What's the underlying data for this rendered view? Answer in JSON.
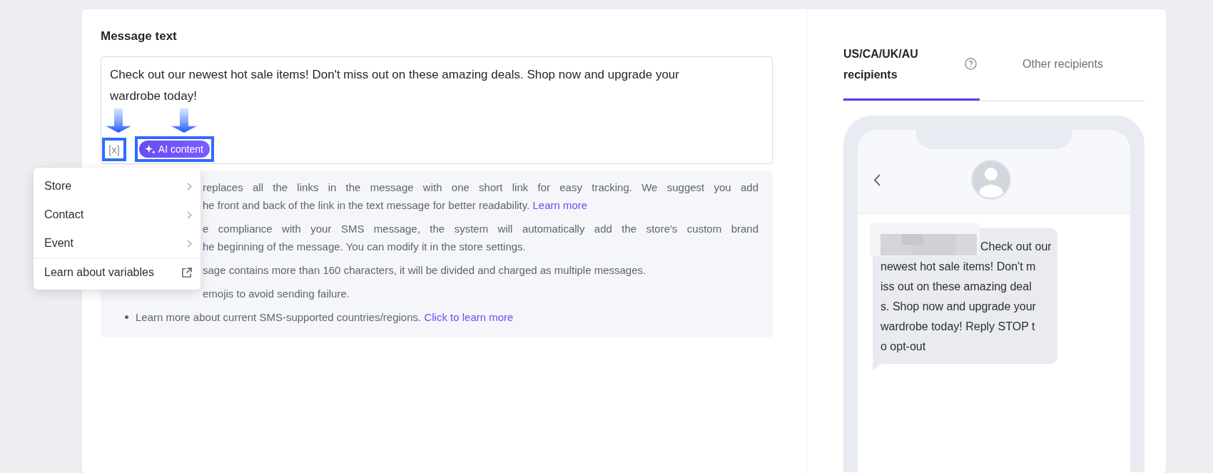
{
  "message_label": "Message text",
  "message_value": "Check out our newest hot sale items! Don't miss out on these amazing deals. Shop now and upgrade your wardrobe today!",
  "variable_button": "[x]",
  "ai_button": "AI content",
  "notes": [
    {
      "kind": "covered",
      "lines": [
        {
          "text": "replaces all the links in the message with one short link for easy tracking. We suggest you add"
        },
        {
          "text": "he front and back of the link in the text message for better readability.",
          "link": "Learn more"
        }
      ]
    },
    {
      "kind": "covered",
      "lines": [
        {
          "text": "e compliance with your SMS message, the system will automatically add the store's custom brand"
        },
        {
          "text": "he beginning of the message. You can modify it in the store settings."
        }
      ]
    },
    {
      "kind": "covered",
      "lines": [
        {
          "text": "sage contains more than 160 characters, it will be divided and charged as multiple messages."
        }
      ]
    },
    {
      "kind": "covered",
      "lines": [
        {
          "text": "emojis to avoid sending failure."
        }
      ]
    },
    {
      "kind": "bullet",
      "lines": [
        {
          "text": "Learn more about current SMS-supported countries/regions.",
          "link": "Click to learn more"
        }
      ]
    }
  ],
  "variable_menu": [
    {
      "label": "Store",
      "kind": "submenu"
    },
    {
      "label": "Contact",
      "kind": "submenu"
    },
    {
      "label": "Event",
      "kind": "submenu"
    },
    {
      "label": "Learn about variables",
      "kind": "external"
    }
  ],
  "tabs": [
    {
      "label": "US/CA/UK/AU recipients",
      "selected": true,
      "help": true
    },
    {
      "label": "Other recipients",
      "selected": false,
      "help": false
    }
  ],
  "preview_lines": [
    "Check out our",
    "newest hot sale items! Don't m",
    "iss out on these amazing deal",
    "s. Shop now and upgrade your",
    "wardrobe today!  Reply STOP t",
    "o opt-out"
  ]
}
